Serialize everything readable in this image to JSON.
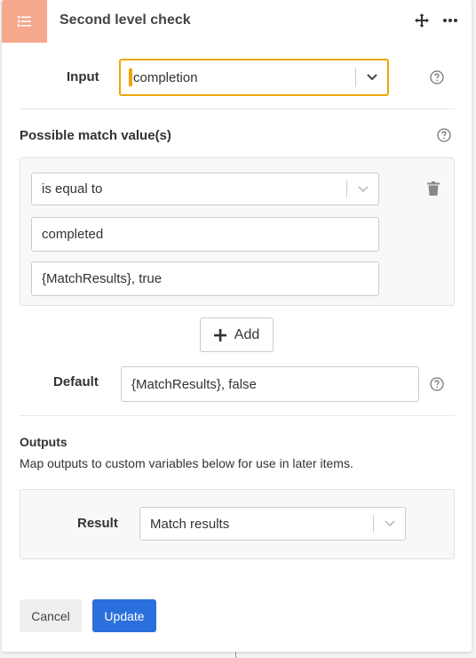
{
  "header": {
    "title": "Second level check"
  },
  "input": {
    "label": "Input",
    "value": "completion"
  },
  "match": {
    "section_label": "Possible match value(s)",
    "operator": "is equal to",
    "value": "completed",
    "result": "{MatchResults}, true",
    "add_label": "Add"
  },
  "default": {
    "label": "Default",
    "value": "{MatchResults}, false"
  },
  "outputs": {
    "label": "Outputs",
    "description": "Map outputs to custom variables below for use in later items.",
    "result_label": "Result",
    "result_value": "Match results"
  },
  "footer": {
    "cancel_label": "Cancel",
    "update_label": "Update"
  },
  "colors": {
    "header_icon_bg": "#f6a88d",
    "focus_border": "#f0a500",
    "update_bg": "#2a6fdb"
  },
  "icons": [
    "list-icon",
    "move-icon",
    "more-icon",
    "help-icon",
    "chevron-down-icon",
    "trash-icon",
    "plus-icon"
  ]
}
